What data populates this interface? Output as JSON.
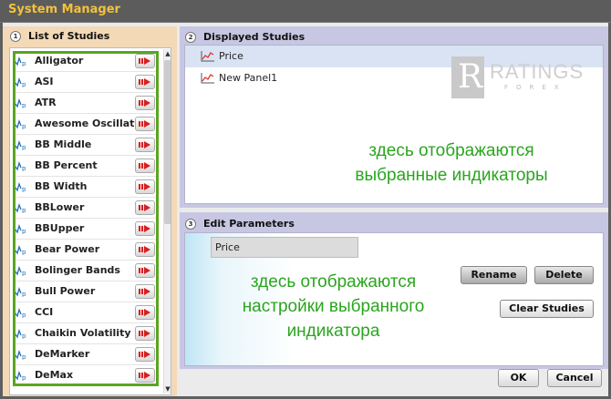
{
  "window": {
    "title": "System Manager"
  },
  "studies_panel": {
    "number": "1",
    "heading": "List of Studies",
    "items": [
      "Alligator",
      "ASI",
      "ATR",
      "Awesome Oscillator",
      "BB Middle",
      "BB Percent",
      "BB Width",
      "BBLower",
      "BBUpper",
      "Bear Power",
      "Bolinger Bands",
      "Bull Power",
      "CCI",
      "Chaikin Volatility",
      "DeMarker",
      "DeMax"
    ]
  },
  "displayed_panel": {
    "number": "2",
    "heading": "Displayed Studies",
    "items": [
      "Price",
      "New Panel1"
    ],
    "selected_index": 0,
    "annotation_line1": "здесь отображаются",
    "annotation_line2": "выбранные индикаторы"
  },
  "logo": {
    "letter": "R",
    "name": "RATINGS",
    "sub": "FOREX"
  },
  "edit_panel": {
    "number": "3",
    "heading": "Edit Parameters",
    "field_value": "Price",
    "rename_label": "Rename",
    "delete_label": "Delete",
    "clear_label": "Clear Studies",
    "annotation_line1": "здесь отображаются",
    "annotation_line2": "настройки выбранного",
    "annotation_line3": "индикатора"
  },
  "footer": {
    "ok_label": "OK",
    "cancel_label": "Cancel"
  },
  "colors": {
    "title": "#f3c23a",
    "annotation": "#2aa51e",
    "frame": "#5aa51e",
    "add_arrow": "#d81e1e"
  }
}
